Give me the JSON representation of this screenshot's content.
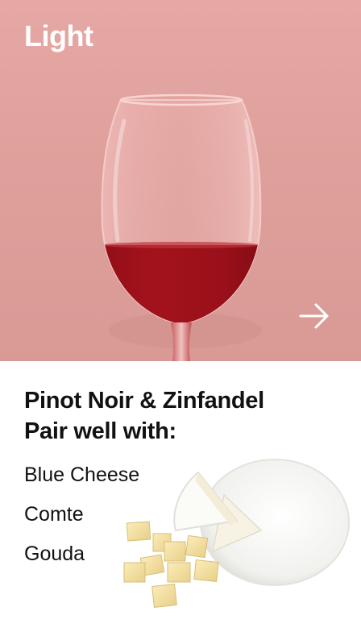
{
  "card": {
    "title": "Light",
    "pairing_heading_line1": "Pinot Noir & Zinfandel",
    "pairing_heading_line2": "Pair well with:",
    "cheeses": [
      "Blue Cheese",
      "Comte",
      "Gouda"
    ]
  },
  "colors": {
    "hero_background": "#dfa09c",
    "wine": "#a3121c",
    "text": "#111111",
    "title_text": "#ffffff"
  },
  "icons": {
    "next": "arrow-right-icon",
    "glass": "wine-glass-image",
    "cheese": "cheese-image"
  }
}
